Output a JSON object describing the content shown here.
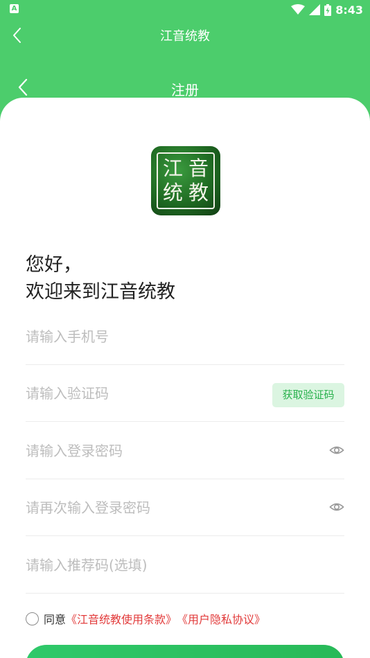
{
  "status_bar": {
    "left_icon": "A",
    "time": "8:43",
    "icons": [
      "wifi-icon",
      "signal-icon",
      "battery-icon"
    ]
  },
  "app_bar": {
    "title": "江音统教",
    "back_icon": "chevron-left-icon"
  },
  "page": {
    "title": "注册",
    "back_icon": "chevron-left-icon"
  },
  "logo": {
    "chars": [
      "江",
      "音",
      "统",
      "教"
    ]
  },
  "greeting": {
    "line1": "您好，",
    "line2": "欢迎来到江音统教"
  },
  "form": {
    "phone_placeholder": "请输入手机号",
    "code_placeholder": "请输入验证码",
    "get_code_label": "获取验证码",
    "password_placeholder": "请输入登录密码",
    "password_confirm_placeholder": "请再次输入登录密码",
    "referral_placeholder": "请输入推荐码(选填)"
  },
  "agreement": {
    "prefix": "同意",
    "terms": "《江音统教使用条款》",
    "privacy": "《用户隐私协议》"
  },
  "colors": {
    "brand_green": "#4ccd6c",
    "button_green": "#2fc96a",
    "link_red": "#e23b3b"
  }
}
